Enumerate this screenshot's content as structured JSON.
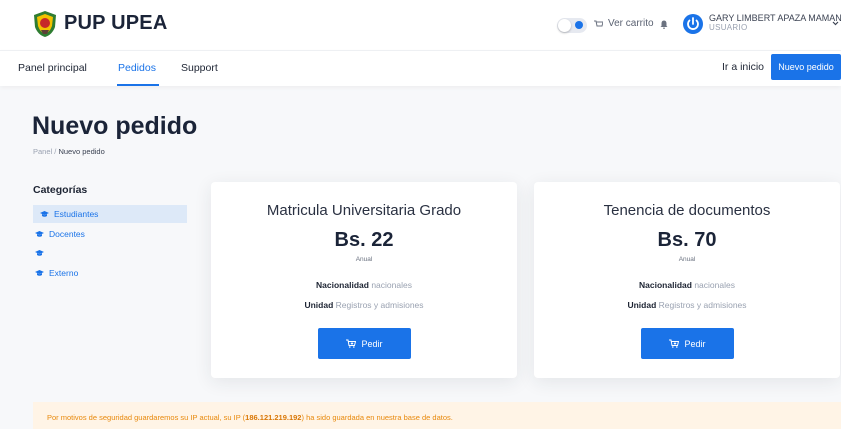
{
  "brand": {
    "name": "PUP UPEA"
  },
  "header": {
    "cart_label": "Ver carrito",
    "user_name": "GARY LIMBERT APAZA MAMANI",
    "user_role": "USUARIO",
    "icons": [
      "theme-toggle-icon",
      "cart-icon",
      "bell-icon",
      "power-icon",
      "chevron-down-icon"
    ]
  },
  "nav": {
    "items": [
      {
        "label": "Panel principal"
      },
      {
        "label": "Pedidos"
      },
      {
        "label": "Support"
      }
    ],
    "active": "Pedidos",
    "home_link": "Ir a inicio",
    "new_order_button": "Nuevo pedido"
  },
  "page": {
    "title": "Nuevo pedido",
    "breadcrumb": {
      "root": "Panel",
      "separator": "/",
      "current": "Nuevo pedido"
    }
  },
  "categories": {
    "title": "Categorías",
    "items": [
      {
        "label": "Estudiantes",
        "selected": true
      },
      {
        "label": "Docentes",
        "selected": false
      },
      {
        "label": "",
        "selected": false
      },
      {
        "label": "Externo",
        "selected": false
      }
    ]
  },
  "cards": [
    {
      "title": "Matricula Universitaria Grado",
      "price": "Bs. 22",
      "period": "Anual",
      "nationality_label": "Nacionalidad",
      "nationality_value": "nacionales",
      "unit_label": "Unidad",
      "unit_value": "Registros y admisiones",
      "button": "Pedir"
    },
    {
      "title": "Tenencia de documentos",
      "price": "Bs. 70",
      "period": "Anual",
      "nationality_label": "Nacionalidad",
      "nationality_value": "nacionales",
      "unit_label": "Unidad",
      "unit_value": "Registros y admisiones",
      "button": "Pedir"
    }
  ],
  "alert": {
    "text_before": "Por motivos de seguridad guardaremos su IP actual, su IP (",
    "ip": "186.121.219.192",
    "text_after": ") ha sido guardada en nuestra base de datos."
  },
  "colors": {
    "accent": "#1a73e8",
    "selected_bg": "#dde9f8",
    "alert_bg": "#fff4e6",
    "alert_text": "#e8890c"
  }
}
